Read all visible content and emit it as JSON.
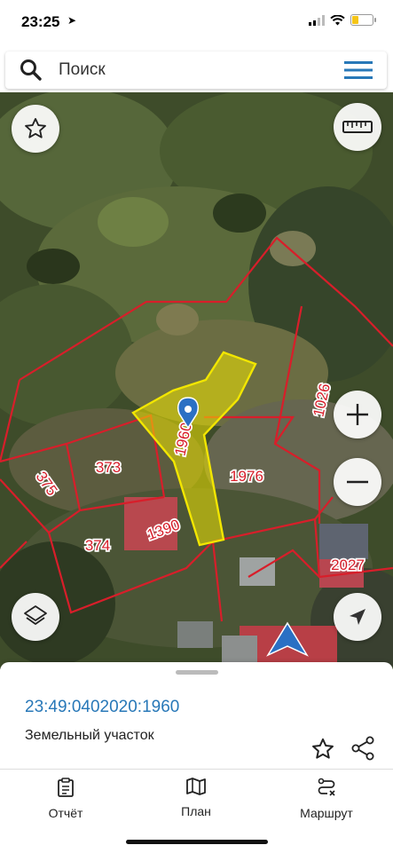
{
  "status": {
    "time": "23:25",
    "location_icon": "location-arrow-icon",
    "battery_color": "#f5c518"
  },
  "search": {
    "placeholder": "Поиск"
  },
  "map": {
    "parcels": [
      "1960",
      "1976",
      "1026",
      "373",
      "375",
      "374",
      "1390",
      "2027"
    ],
    "selection_color": "#f2e600",
    "boundary_color": "#d81e2a"
  },
  "sheet": {
    "cadastral_number": "23:49:0402020:1960",
    "object_type": "Земельный участок"
  },
  "tabs": [
    {
      "label": "Отчёт",
      "icon": "clipboard-icon"
    },
    {
      "label": "План",
      "icon": "map-icon"
    },
    {
      "label": "Маршрут",
      "icon": "route-icon"
    }
  ]
}
